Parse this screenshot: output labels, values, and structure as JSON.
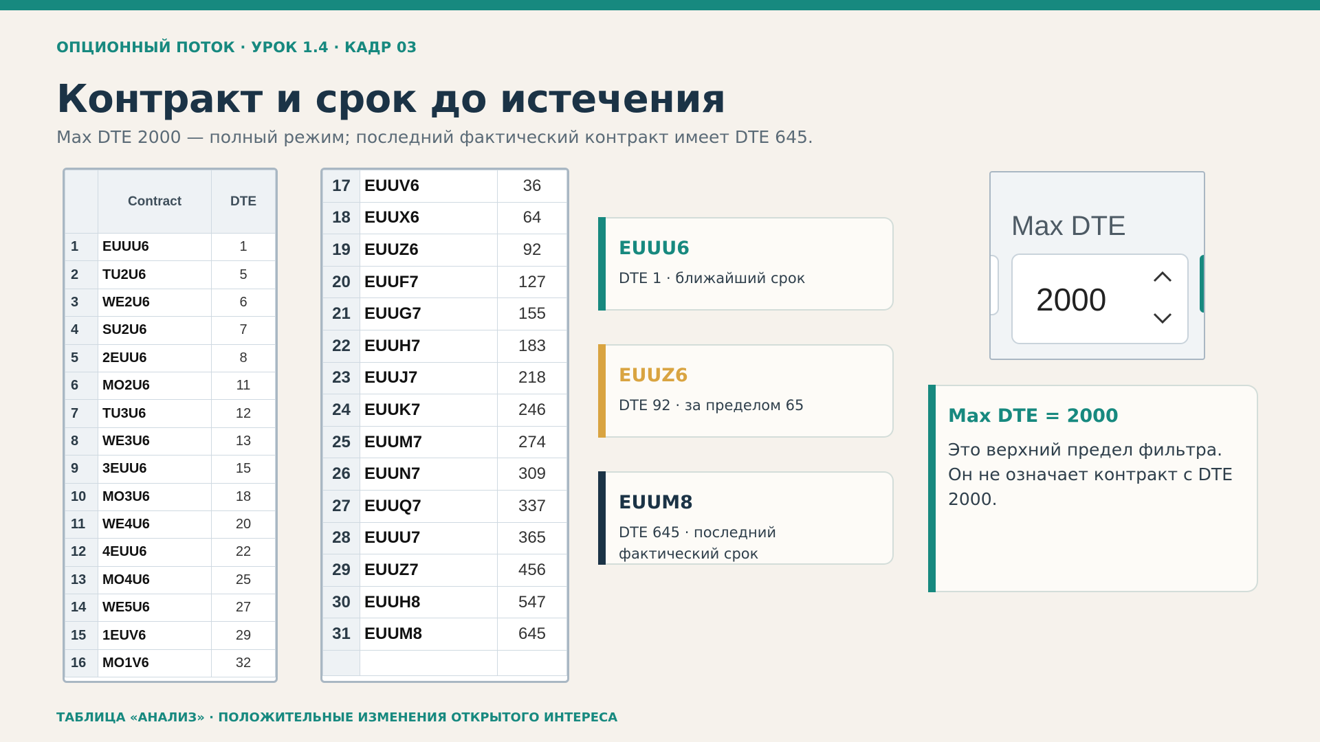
{
  "header": {
    "kicker": "ОПЦИОННЫЙ ПОТОК · УРОК 1.4 · КАДР 03",
    "title": "Контракт и срок до истечения",
    "subtitle": "Max DTE 2000 — полный режим; последний фактический контракт имеет DTE 645."
  },
  "table_left": {
    "headers": {
      "contract": "Contract",
      "dte": "DTE"
    },
    "rows": [
      {
        "n": "1",
        "contract": "EUUU6",
        "dte": "1"
      },
      {
        "n": "2",
        "contract": "TU2U6",
        "dte": "5"
      },
      {
        "n": "3",
        "contract": "WE2U6",
        "dte": "6"
      },
      {
        "n": "4",
        "contract": "SU2U6",
        "dte": "7"
      },
      {
        "n": "5",
        "contract": "2EUU6",
        "dte": "8"
      },
      {
        "n": "6",
        "contract": "MO2U6",
        "dte": "11"
      },
      {
        "n": "7",
        "contract": "TU3U6",
        "dte": "12"
      },
      {
        "n": "8",
        "contract": "WE3U6",
        "dte": "13"
      },
      {
        "n": "9",
        "contract": "3EUU6",
        "dte": "15"
      },
      {
        "n": "10",
        "contract": "MO3U6",
        "dte": "18"
      },
      {
        "n": "11",
        "contract": "WE4U6",
        "dte": "20"
      },
      {
        "n": "12",
        "contract": "4EUU6",
        "dte": "22"
      },
      {
        "n": "13",
        "contract": "MO4U6",
        "dte": "25"
      },
      {
        "n": "14",
        "contract": "WE5U6",
        "dte": "27"
      },
      {
        "n": "15",
        "contract": "1EUV6",
        "dte": "29"
      },
      {
        "n": "16",
        "contract": "MO1V6",
        "dte": "32"
      }
    ]
  },
  "table_right": {
    "rows": [
      {
        "n": "17",
        "contract": "EUUV6",
        "dte": "36"
      },
      {
        "n": "18",
        "contract": "EUUX6",
        "dte": "64"
      },
      {
        "n": "19",
        "contract": "EUUZ6",
        "dte": "92"
      },
      {
        "n": "20",
        "contract": "EUUF7",
        "dte": "127"
      },
      {
        "n": "21",
        "contract": "EUUG7",
        "dte": "155"
      },
      {
        "n": "22",
        "contract": "EUUH7",
        "dte": "183"
      },
      {
        "n": "23",
        "contract": "EUUJ7",
        "dte": "218"
      },
      {
        "n": "24",
        "contract": "EUUK7",
        "dte": "246"
      },
      {
        "n": "25",
        "contract": "EUUM7",
        "dte": "274"
      },
      {
        "n": "26",
        "contract": "EUUN7",
        "dte": "309"
      },
      {
        "n": "27",
        "contract": "EUUQ7",
        "dte": "337"
      },
      {
        "n": "28",
        "contract": "EUUU7",
        "dte": "365"
      },
      {
        "n": "29",
        "contract": "EUUZ7",
        "dte": "456"
      },
      {
        "n": "30",
        "contract": "EUUH8",
        "dte": "547"
      },
      {
        "n": "31",
        "contract": "EUUM8",
        "dte": "645"
      }
    ]
  },
  "cards": [
    {
      "title": "EUUU6",
      "desc": "DTE 1 · ближайший срок",
      "color": "#17897f",
      "title_color": "#17897f"
    },
    {
      "title": "EUUZ6",
      "desc": "DTE 92 · за пределом 65",
      "color": "#d9a441",
      "title_color": "#d9a441"
    },
    {
      "title": "EUUM8",
      "desc": "DTE 645 · последний фактический срок",
      "color": "#1b3346",
      "title_color": "#1b3346"
    }
  ],
  "max_dte_widget": {
    "label": "Max DTE",
    "value": "2000",
    "up_icon": "chevron-up-icon",
    "down_icon": "chevron-down-icon"
  },
  "note": {
    "title": "Max DTE = 2000",
    "text": "Это верхний предел фильтра. Он не означает контракт с DTE 2000."
  },
  "footer": {
    "text": "ТАБЛИЦА «АНАЛИЗ» · ПОЛОЖИТЕЛЬНЫЕ ИЗМЕНЕНИЯ ОТКРЫТОГО ИНТЕРЕСА"
  },
  "colors": {
    "accent": "#17897f",
    "warning": "#d9a441",
    "dark": "#1b3346",
    "background": "#f6f2ec"
  }
}
